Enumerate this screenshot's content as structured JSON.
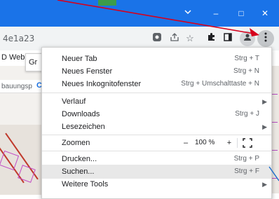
{
  "titlebar": {
    "tab_search_icon": "chevron-down-icon",
    "minimize": "–",
    "maximize": "□",
    "close": "✕"
  },
  "toolbar": {
    "url_fragment": "4e1a23",
    "icons": [
      "lens-icon",
      "share-icon",
      "star-icon",
      "extensions-icon",
      "side-panel-icon",
      "profile-icon",
      "kebab-menu-icon"
    ]
  },
  "bookmarks": {
    "item": "D Web("
  },
  "tooltip": {
    "text": "Gr"
  },
  "page": {
    "label": "bauungsp",
    "c": "C"
  },
  "menu": {
    "items": [
      {
        "label": "Neuer Tab",
        "shortcut": "Strg + T"
      },
      {
        "label": "Neues Fenster",
        "shortcut": "Strg + N"
      },
      {
        "label": "Neues Inkognitofenster",
        "shortcut": "Strg + Umschalttaste + N"
      },
      {
        "label": "Verlauf",
        "shortcut": "",
        "submenu": true
      },
      {
        "label": "Downloads",
        "shortcut": "Strg + J"
      },
      {
        "label": "Lesezeichen",
        "shortcut": "",
        "submenu": true
      },
      {
        "label": "Zoomen",
        "zoom": {
          "minus": "–",
          "value": "100 %",
          "plus": "+"
        }
      },
      {
        "label": "Drucken...",
        "shortcut": "Strg + P"
      },
      {
        "label": "Suchen...",
        "shortcut": "Strg + F",
        "highlighted": true
      },
      {
        "label": "Weitere Tools",
        "shortcut": "",
        "submenu": true
      }
    ]
  },
  "colors": {
    "titlebar": "#1a73e8",
    "arrow": "#d6001c"
  }
}
